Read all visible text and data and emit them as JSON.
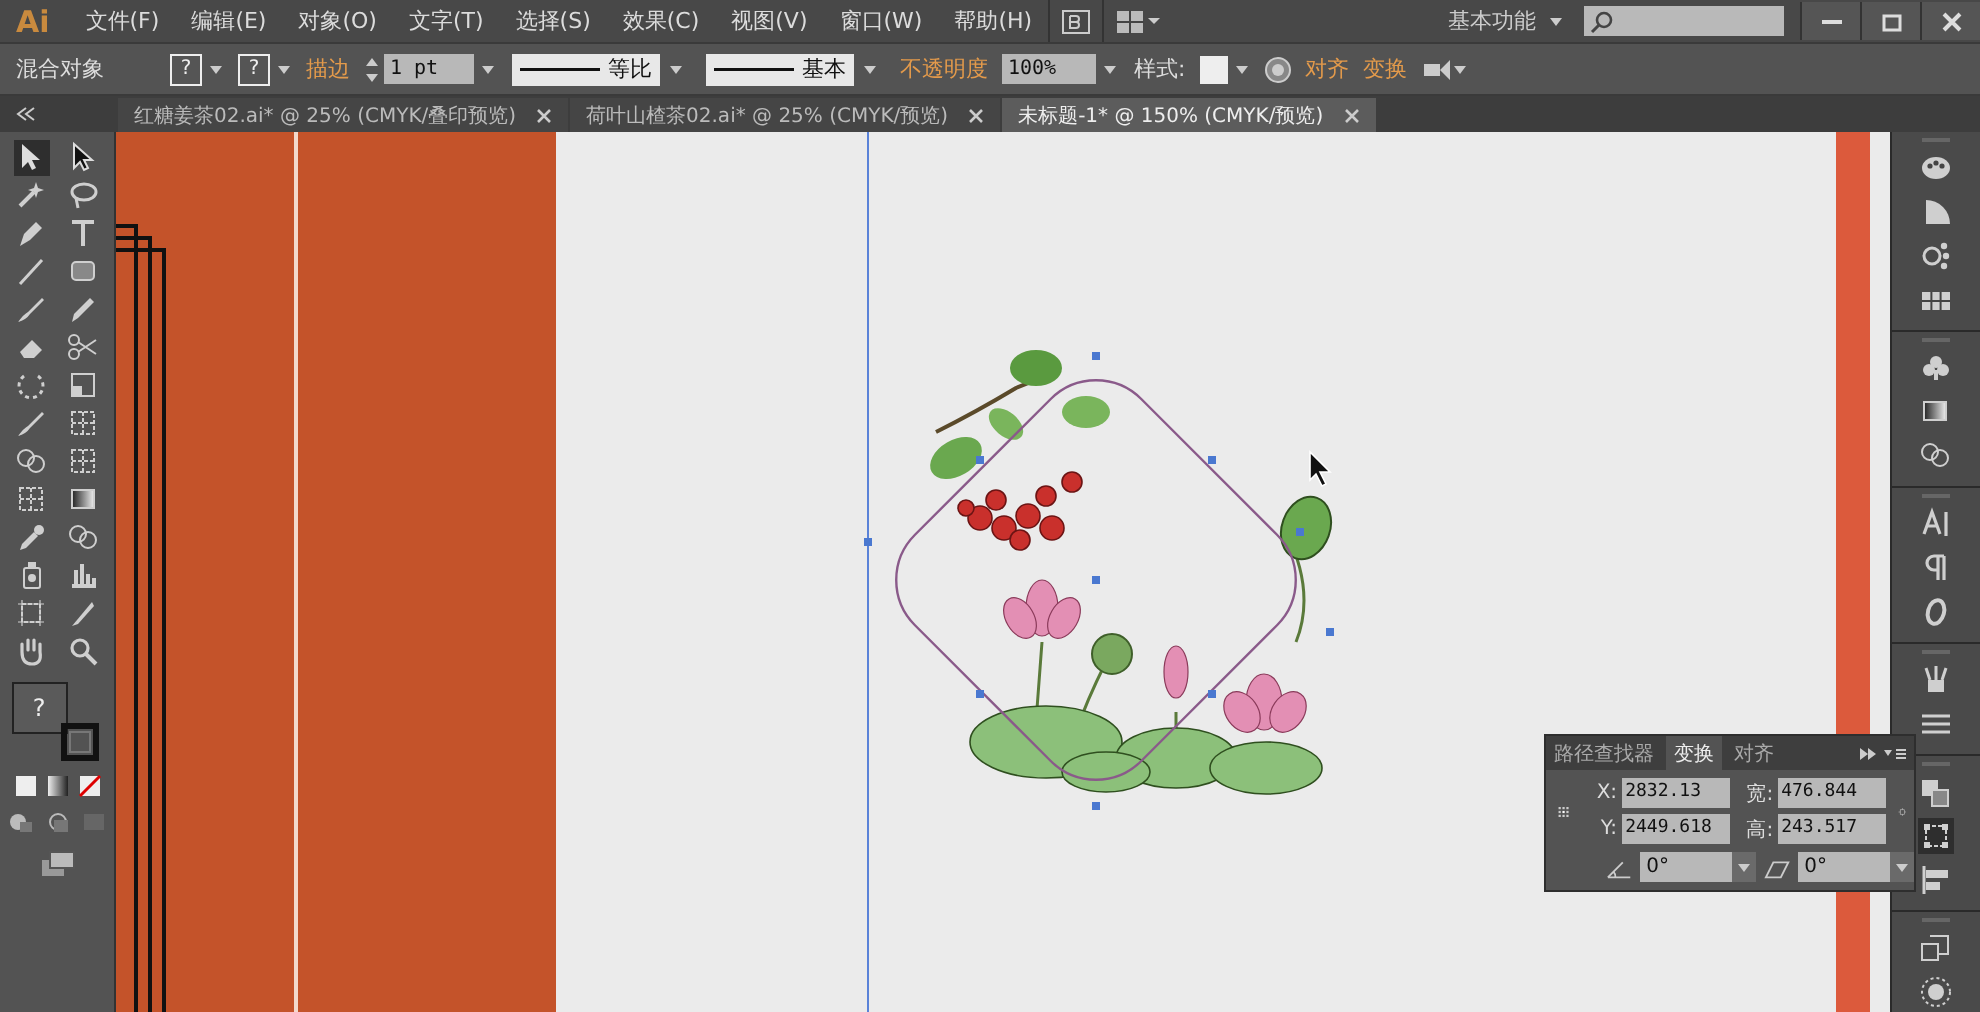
{
  "app": {
    "logo": "Ai"
  },
  "menu": [
    "文件(F)",
    "编辑(E)",
    "对象(O)",
    "文字(T)",
    "选择(S)",
    "效果(C)",
    "视图(V)",
    "窗口(W)",
    "帮助(H)"
  ],
  "workspace": {
    "label": "基本功能"
  },
  "control_bar": {
    "selection_label": "混合对象",
    "fill_mark": "?",
    "stroke_mark": "?",
    "stroke_label": "描边",
    "stroke_weight": "1 pt",
    "profile": "等比",
    "brush": "基本",
    "opacity_label": "不透明度",
    "opacity": "100%",
    "style_label": "样式:",
    "align_link": "对齐",
    "transform_link": "变换"
  },
  "tabs": [
    {
      "label": "红糖姜茶02.ai* @ 25% (CMYK/叠印预览)",
      "selected": false
    },
    {
      "label": "荷叶山楂茶02.ai* @ 25% (CMYK/预览)",
      "selected": false
    },
    {
      "label": "未标题-1* @ 150% (CMYK/预览)",
      "selected": true
    }
  ],
  "toolbox": {
    "fill_mark": "?"
  },
  "transform_panel": {
    "tabs": [
      {
        "label": "路径查找器",
        "selected": false
      },
      {
        "label": "变换",
        "selected": true
      },
      {
        "label": "对齐",
        "selected": false
      }
    ],
    "fields": [
      {
        "label": "X:",
        "value": "2832.13"
      },
      {
        "label": "宽:",
        "value": "476.844"
      },
      {
        "label": "Y:",
        "value": "2449.618"
      },
      {
        "label": "高:",
        "value": "243.517"
      }
    ],
    "angles": [
      "0°",
      "0°"
    ]
  }
}
